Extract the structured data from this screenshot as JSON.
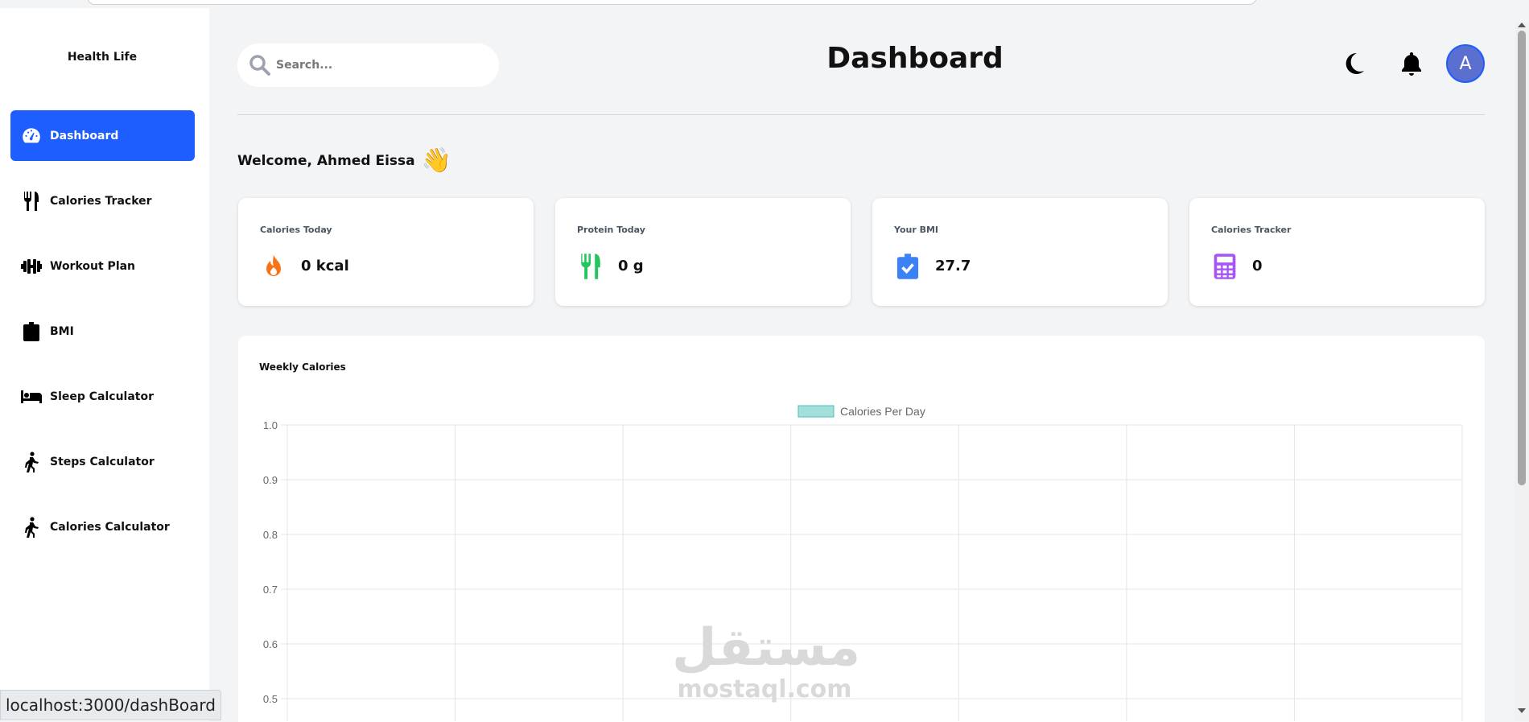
{
  "sidebar": {
    "brand": "Health Life",
    "items": [
      {
        "label": "Dashboard",
        "icon": "gauge-icon"
      },
      {
        "label": "Calories Tracker",
        "icon": "utensils-icon"
      },
      {
        "label": "Workout Plan",
        "icon": "dumbbell-icon"
      },
      {
        "label": "BMI",
        "icon": "clipboard-check-icon"
      },
      {
        "label": "Sleep Calculator",
        "icon": "bed-icon"
      },
      {
        "label": "Steps Calculator",
        "icon": "walking-icon"
      },
      {
        "label": "Calories Calculator",
        "icon": "walking-icon"
      }
    ],
    "active": "Dashboard"
  },
  "status_bar": {
    "url": "localhost:3000/dashBoard"
  },
  "header": {
    "search_placeholder": "Search...",
    "title": "Dashboard",
    "theme_icon": "moon-icon",
    "notifications_icon": "bell-icon",
    "avatar_initial": "A"
  },
  "welcome": {
    "text": "Welcome, Ahmed Eissa",
    "emoji": "👋"
  },
  "cards": [
    {
      "title": "Calories Today",
      "value": "0 kcal",
      "icon": "fire-icon",
      "color": "#f97316"
    },
    {
      "title": "Protein Today",
      "value": "0 g",
      "icon": "utensils-icon",
      "color": "#22c55e"
    },
    {
      "title": "Your BMI",
      "value": "27.7",
      "icon": "clipboard-check-icon",
      "color": "#3b82f6"
    },
    {
      "title": "Calories Tracker",
      "value": "0",
      "icon": "calculator-icon",
      "color": "#a855f7"
    }
  ],
  "colors": {
    "accent": "#1e5eff",
    "legend_fill": "#a5dfdb",
    "legend_stroke": "#4bc0c0"
  },
  "chart_data": {
    "type": "bar",
    "title": "Weekly Calories",
    "series": [
      {
        "name": "Calories Per Day",
        "values": []
      }
    ],
    "y_ticks": [
      "1.0",
      "0.9",
      "0.8",
      "0.7",
      "0.6",
      "0.5"
    ],
    "ylim": [
      0.5,
      1.0
    ],
    "grid": true,
    "legend_position": "top",
    "visible_vertical_gridlines": 8
  },
  "watermark": {
    "arabic": "مستقل",
    "latin": "mostaql.com"
  }
}
